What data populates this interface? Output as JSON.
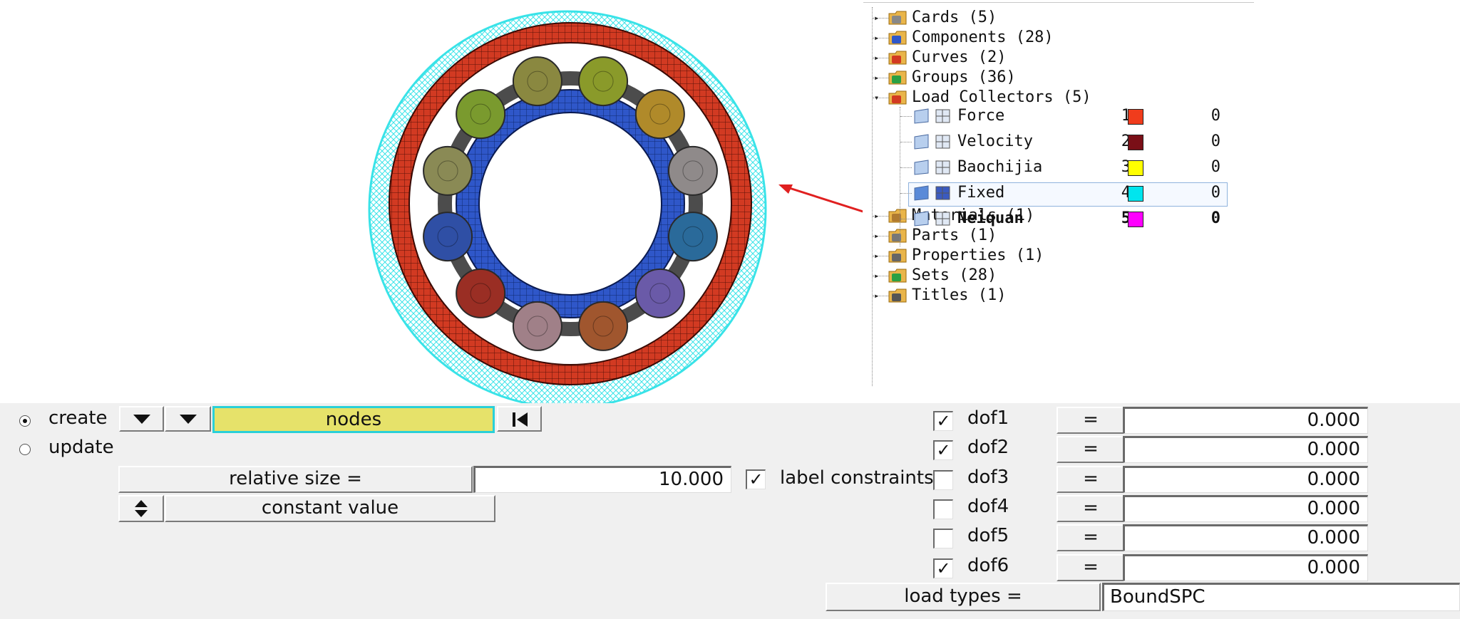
{
  "tree": {
    "items": [
      {
        "label": "Cards (5)",
        "icon": "cards-folder-icon",
        "expander": "▸"
      },
      {
        "label": "Components (28)",
        "icon": "components-folder-icon",
        "expander": "▸"
      },
      {
        "label": "Curves (2)",
        "icon": "curves-folder-icon",
        "expander": "▸"
      },
      {
        "label": "Groups (36)",
        "icon": "groups-folder-icon",
        "expander": "▸"
      },
      {
        "label": "Load Collectors (5)",
        "icon": "load-collectors-folder-icon",
        "expander": "▾"
      },
      {
        "label": "Materials (1)",
        "icon": "materials-folder-icon",
        "expander": "▸"
      },
      {
        "label": "Parts (1)",
        "icon": "parts-folder-icon",
        "expander": "▸"
      },
      {
        "label": "Properties (1)",
        "icon": "properties-folder-icon",
        "expander": "▸"
      },
      {
        "label": "Sets (28)",
        "icon": "sets-folder-icon",
        "expander": "▸"
      },
      {
        "label": "Titles (1)",
        "icon": "titles-folder-icon",
        "expander": "▸"
      }
    ],
    "load_collectors": [
      {
        "name": "Force",
        "id": "1",
        "color": "#f03c1c",
        "value": "0",
        "bold": false,
        "selected": false
      },
      {
        "name": "Velocity",
        "id": "2",
        "color": "#7a0f17",
        "value": "0",
        "bold": false,
        "selected": false
      },
      {
        "name": "Baochijia",
        "id": "3",
        "color": "#ffff00",
        "value": "0",
        "bold": false,
        "selected": false
      },
      {
        "name": "Fixed",
        "id": "4",
        "color": "#00e5ee",
        "value": "0",
        "bold": false,
        "selected": true
      },
      {
        "name": "Neiquan",
        "id": "5",
        "color": "#ff00ff",
        "value": "0",
        "bold": true,
        "selected": false
      }
    ]
  },
  "viewport": {
    "colors": {
      "outer_constraint": "#39e3e8",
      "outer_race": "#d23a22",
      "inner_race": "#2f57c9",
      "cage": "#4c4c4c"
    },
    "balls": [
      {
        "color": "#8a8840"
      },
      {
        "color": "#8a9a2a"
      },
      {
        "color": "#b08a2a"
      },
      {
        "color": "#8f8a8a"
      },
      {
        "color": "#2a6a9a"
      },
      {
        "color": "#6a5aa8"
      },
      {
        "color": "#a0562e"
      },
      {
        "color": "#a08088"
      },
      {
        "color": "#9a2e24"
      },
      {
        "color": "#2f4fa5"
      },
      {
        "color": "#8a8a55"
      },
      {
        "color": "#7a9a2e"
      }
    ],
    "cage_links": [
      {
        "color": "#b08a2a"
      },
      {
        "color": "#6a6a6a"
      },
      {
        "color": "#4a6aa0"
      },
      {
        "color": "#4a4a4a"
      },
      {
        "color": "#7a4aa0"
      },
      {
        "color": "#a0452e"
      },
      {
        "color": "#8a8a8a"
      },
      {
        "color": "#c0502e"
      },
      {
        "color": "#6a6a6a"
      },
      {
        "color": "#3a55a0"
      },
      {
        "color": "#8a9a2a"
      },
      {
        "color": "#a08a2a"
      }
    ],
    "arrow_color": "#e02020"
  },
  "panel": {
    "create_label": "create",
    "update_label": "update",
    "nodes_label": "nodes",
    "relative_size_label": "relative size =",
    "relative_size_value": "10.000",
    "label_constraints_label": "label constraints",
    "label_constraints_checked": "✓",
    "constant_value_label": "constant value",
    "dofs": [
      {
        "name": "dof1",
        "checked": "✓",
        "eq": "=",
        "value": "0.000"
      },
      {
        "name": "dof2",
        "checked": "✓",
        "eq": "=",
        "value": "0.000"
      },
      {
        "name": "dof3",
        "checked": "",
        "eq": "=",
        "value": "0.000"
      },
      {
        "name": "dof4",
        "checked": "",
        "eq": "=",
        "value": "0.000"
      },
      {
        "name": "dof5",
        "checked": "",
        "eq": "=",
        "value": "0.000"
      },
      {
        "name": "dof6",
        "checked": "✓",
        "eq": "=",
        "value": "0.000"
      }
    ],
    "load_types_label": "load types =",
    "load_types_value": "BoundSPC",
    "colors": {
      "nodes_bg": "#e6e26a",
      "nodes_border": "#2ad0d8"
    }
  }
}
